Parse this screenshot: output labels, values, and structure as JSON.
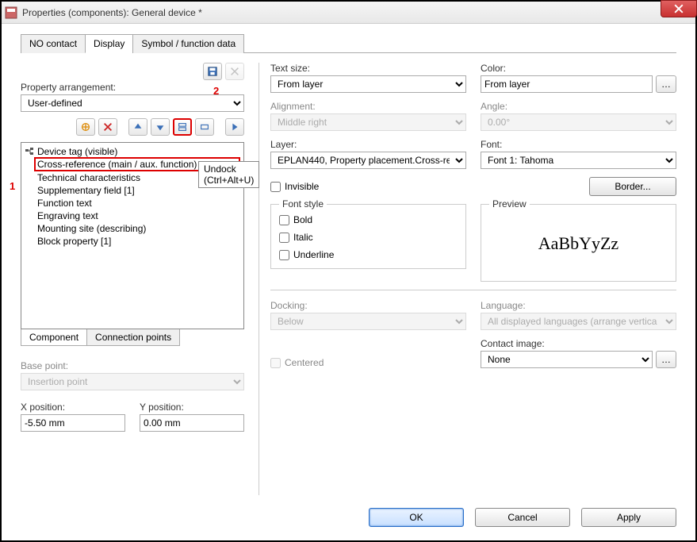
{
  "window": {
    "title": "Properties (components): General device *"
  },
  "tabs": [
    {
      "label": "NO contact"
    },
    {
      "label": "Display"
    },
    {
      "label": "Symbol / function data"
    }
  ],
  "active_tab": 1,
  "annotations": {
    "one": "1",
    "two": "2"
  },
  "left": {
    "arrangement_label": "Property arrangement:",
    "arrangement_value": "User-defined",
    "tooltip": "Undock (Ctrl+Alt+U)",
    "list_root": "Device tag (visible)",
    "items": [
      "Cross-reference (main / aux. function)",
      "Technical characteristics",
      "Supplementary field [1]",
      "Function text",
      "Engraving text",
      "Mounting site (describing)",
      "Block property [1]"
    ],
    "selected_index": 0,
    "subtabs": [
      {
        "label": "Component"
      },
      {
        "label": "Connection points"
      }
    ],
    "subtab_active": 0,
    "basepoint_label": "Base point:",
    "basepoint_value": "Insertion point",
    "xpos_label": "X position:",
    "xpos_value": "-5.50 mm",
    "ypos_label": "Y position:",
    "ypos_value": "0.00 mm"
  },
  "right": {
    "textsize_label": "Text size:",
    "textsize_value": "From layer",
    "color_label": "Color:",
    "color_value": "From layer",
    "alignment_label": "Alignment:",
    "alignment_value": "Middle right",
    "angle_label": "Angle:",
    "angle_value": "0.00°",
    "layer_label": "Layer:",
    "layer_value": "EPLAN440, Property placement.Cross-re",
    "font_label": "Font:",
    "font_value": "Font 1: Tahoma",
    "invisible_label": "Invisible",
    "border_button": "Border...",
    "fontstyle_legend": "Font style",
    "bold_label": "Bold",
    "italic_label": "Italic",
    "underline_label": "Underline",
    "preview_legend": "Preview",
    "preview_text": "AaBbYyZz",
    "docking_label": "Docking:",
    "docking_value": "Below",
    "language_label": "Language:",
    "language_value": "All displayed languages (arrange vertica",
    "centered_label": "Centered",
    "contactimage_label": "Contact image:",
    "contactimage_value": "None"
  },
  "buttons": {
    "ok": "OK",
    "cancel": "Cancel",
    "apply": "Apply"
  }
}
